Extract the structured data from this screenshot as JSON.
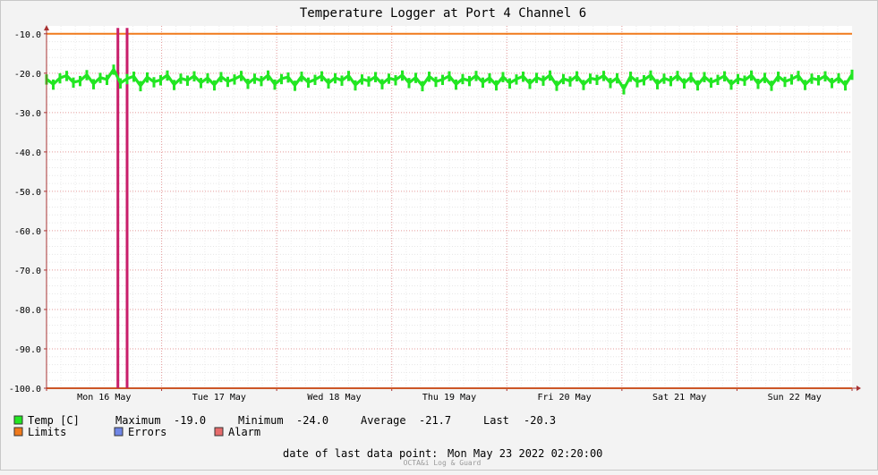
{
  "chart_data": {
    "type": "line",
    "title": "Temperature Logger at Port 4 Channel 6",
    "ylim": [
      -100,
      -8
    ],
    "yticks": [
      "-10.0",
      "-20.0",
      "-30.0",
      "-40.0",
      "-50.0",
      "-60.0",
      "-70.0",
      "-80.0",
      "-90.0",
      "-100.0"
    ],
    "ytick_values": [
      -10,
      -20,
      -30,
      -40,
      -50,
      -60,
      -70,
      -80,
      -90,
      -100
    ],
    "xlim_days": [
      0,
      7.0
    ],
    "xticks": [
      "Mon 16 May",
      "Tue 17 May",
      "Wed 18 May",
      "Thu 19 May",
      "Fri 20 May",
      "Sat 21 May",
      "Sun 22 May"
    ],
    "grid": true,
    "series": [
      {
        "name": "Temp [C]",
        "color": "#22e622",
        "maximum": -19.0,
        "minimum": -24.0,
        "average": -21.7,
        "last": -20.3,
        "values": [
          -21.5,
          -22.8,
          -21.2,
          -20.6,
          -22.3,
          -21.9,
          -20.4,
          -22.7,
          -21.1,
          -21.6,
          -19.0,
          -22.5,
          -21.4,
          -20.8,
          -23.2,
          -21.0,
          -22.2,
          -21.7,
          -20.5,
          -22.9,
          -21.3,
          -21.8,
          -20.7,
          -22.4,
          -21.2,
          -23.0,
          -20.9,
          -22.1,
          -21.5,
          -20.6,
          -22.6,
          -21.3,
          -21.9,
          -20.5,
          -22.8,
          -21.4,
          -21.0,
          -23.1,
          -20.8,
          -22.3,
          -21.6,
          -20.7,
          -22.5,
          -21.2,
          -21.8,
          -20.6,
          -23.0,
          -21.5,
          -22.0,
          -20.9,
          -22.7,
          -21.3,
          -21.7,
          -20.5,
          -22.4,
          -21.1,
          -23.2,
          -20.8,
          -22.1,
          -21.6,
          -20.7,
          -22.8,
          -21.4,
          -21.9,
          -20.6,
          -22.3,
          -21.2,
          -23.0,
          -20.9,
          -22.5,
          -21.5,
          -20.8,
          -22.6,
          -21.1,
          -21.8,
          -20.5,
          -23.1,
          -21.4,
          -22.0,
          -20.7,
          -22.9,
          -21.3,
          -21.6,
          -20.6,
          -22.4,
          -21.2,
          -24.0,
          -20.8,
          -22.2,
          -21.7,
          -20.5,
          -22.7,
          -21.3,
          -21.9,
          -20.6,
          -22.5,
          -21.0,
          -23.0,
          -20.9,
          -22.3,
          -21.6,
          -20.7,
          -22.8,
          -21.4,
          -21.8,
          -20.5,
          -22.6,
          -21.1,
          -23.1,
          -20.8,
          -22.1,
          -21.5,
          -20.6,
          -22.9,
          -21.3,
          -21.7,
          -20.7,
          -22.4,
          -21.2,
          -23.0,
          -20.3
        ]
      },
      {
        "name": "Limits",
        "color": "#f07a1c",
        "values": [
          -10,
          -100
        ]
      }
    ],
    "alarm_markers_days": [
      0.62,
      0.7
    ],
    "alarm_color": "#c81e6a",
    "legend": {
      "temp_label": "Temp [C]",
      "max_label": "Maximum",
      "max_value": "-19.0",
      "min_label": "Minimum",
      "min_value": "-24.0",
      "avg_label": "Average",
      "avg_value": "-21.7",
      "last_label": "Last",
      "last_value": "-20.3",
      "limits_label": "Limits",
      "errors_label": "Errors",
      "alarm_label": "Alarm",
      "temp_color": "#22e622",
      "limits_color": "#f07a1c",
      "errors_color": "#6f86e6",
      "alarm_color": "#e66b6b"
    },
    "footer": {
      "last_point_label": "date of last data point:",
      "last_point_value": "Mon May 23 2022 02:20:00",
      "credit": "OCTA&i Log & Guard"
    }
  }
}
